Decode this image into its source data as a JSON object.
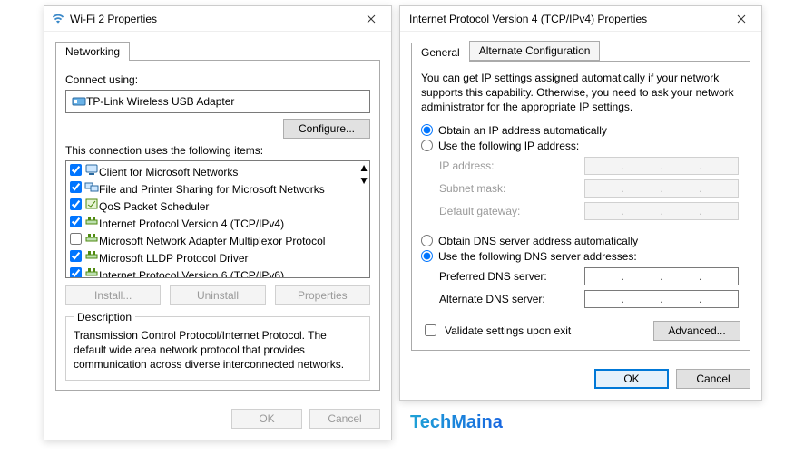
{
  "left": {
    "title": "Wi-Fi 2 Properties",
    "tabs": {
      "networking": "Networking"
    },
    "connect_using_label": "Connect using:",
    "adapter_name": "TP-Link Wireless USB Adapter",
    "configure_btn": "Configure...",
    "items_label": "This connection uses the following items:",
    "items": [
      {
        "checked": true,
        "label": "Client for Microsoft Networks",
        "icon": "client"
      },
      {
        "checked": true,
        "label": "File and Printer Sharing for Microsoft Networks",
        "icon": "share"
      },
      {
        "checked": true,
        "label": "QoS Packet Scheduler",
        "icon": "qos"
      },
      {
        "checked": true,
        "label": "Internet Protocol Version 4 (TCP/IPv4)",
        "icon": "proto",
        "selected": true
      },
      {
        "checked": false,
        "label": "Microsoft Network Adapter Multiplexor Protocol",
        "icon": "proto"
      },
      {
        "checked": true,
        "label": "Microsoft LLDP Protocol Driver",
        "icon": "proto"
      },
      {
        "checked": true,
        "label": "Internet Protocol Version 6 (TCP/IPv6)",
        "icon": "proto"
      }
    ],
    "install_btn": "Install...",
    "uninstall_btn": "Uninstall",
    "properties_btn": "Properties",
    "desc_title": "Description",
    "desc_text": "Transmission Control Protocol/Internet Protocol. The default wide area network protocol that provides communication across diverse interconnected networks.",
    "ok_btn": "OK",
    "cancel_btn": "Cancel"
  },
  "right": {
    "title": "Internet Protocol Version 4 (TCP/IPv4) Properties",
    "tabs": {
      "general": "General",
      "alt": "Alternate Configuration"
    },
    "intro": "You can get IP settings assigned automatically if your network supports this capability. Otherwise, you need to ask your network administrator for the appropriate IP settings.",
    "radio_ip_auto": "Obtain an IP address automatically",
    "radio_ip_manual": "Use the following IP address:",
    "ip_address_label": "IP address:",
    "subnet_label": "Subnet mask:",
    "gateway_label": "Default gateway:",
    "radio_dns_auto": "Obtain DNS server address automatically",
    "radio_dns_manual": "Use the following DNS server addresses:",
    "dns_pref_label": "Preferred DNS server:",
    "dns_alt_label": "Alternate DNS server:",
    "validate_label": "Validate settings upon exit",
    "advanced_btn": "Advanced...",
    "ok_btn": "OK",
    "cancel_btn": "Cancel",
    "state": {
      "ip_mode": "auto",
      "dns_mode": "manual",
      "validate_checked": false
    }
  },
  "watermark": "TechMaina"
}
